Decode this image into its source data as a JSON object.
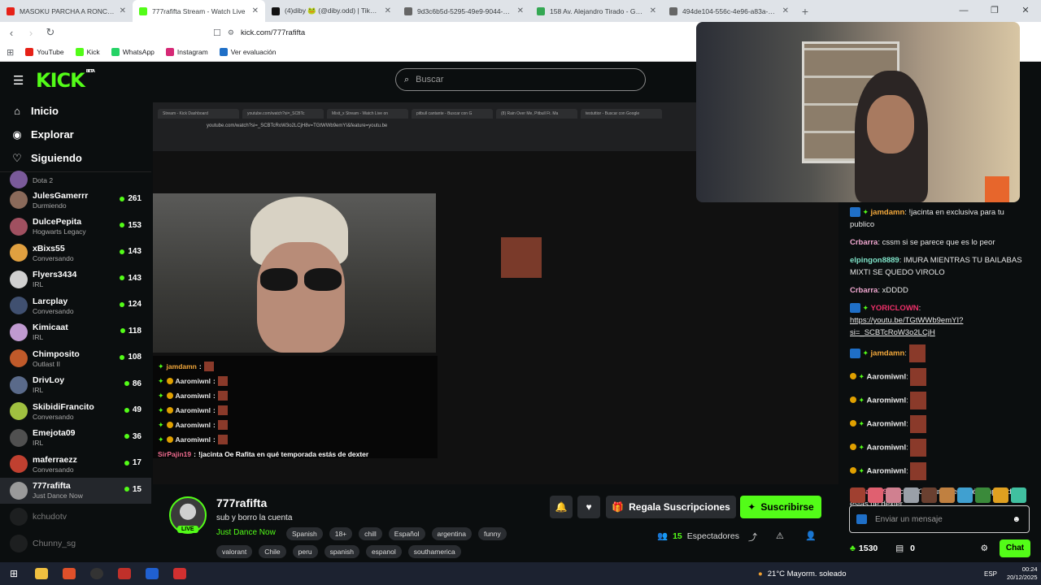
{
  "browser": {
    "tabs": [
      {
        "title": "MASOKU PARCHA A RONCHAS",
        "color": "#e62117",
        "active": false
      },
      {
        "title": "777rafifta Stream - Watch Live",
        "color": "#53fc18",
        "active": true
      },
      {
        "title": "(4)diby 🐸 (@diby.odd) | TikTok",
        "color": "#111111",
        "active": false
      },
      {
        "title": "9d3c6b5d-5295-49e9-9044-95eba9b",
        "color": "#666666",
        "active": false
      },
      {
        "title": "158 Av. Alejandro Tirado - Google M",
        "color": "#34a853",
        "active": false
      },
      {
        "title": "494de104-556c-4e96-a83a-1e4902d9",
        "color": "#666666",
        "active": false
      }
    ],
    "url": "kick.com/777rafifta",
    "bookmarks": [
      {
        "label": "YouTube",
        "color": "#e62117"
      },
      {
        "label": "Kick",
        "color": "#53fc18"
      },
      {
        "label": "WhatsApp",
        "color": "#25d366"
      },
      {
        "label": "Instagram",
        "color": "#d62976"
      },
      {
        "label": "Ver evaluación",
        "color": "#1f6fc7"
      }
    ]
  },
  "kick": {
    "logo": "KICK",
    "beta": "BETA",
    "search_placeholder": "Buscar",
    "nav": [
      {
        "label": "Inicio",
        "icon": "home-icon"
      },
      {
        "label": "Explorar",
        "icon": "compass-icon"
      },
      {
        "label": "Siguiendo",
        "icon": "heart-icon"
      }
    ],
    "channels": [
      {
        "name": "",
        "category": "Dota 2",
        "viewers": "",
        "color": "#7a5a9a",
        "state": "partial"
      },
      {
        "name": "JulesGamerrr",
        "category": "Durmiendo",
        "viewers": "261",
        "color": "#8a6a5a",
        "state": "on"
      },
      {
        "name": "DulcePepita",
        "category": "Hogwarts Legacy",
        "viewers": "153",
        "color": "#a05060",
        "state": "on"
      },
      {
        "name": "xBixs55",
        "category": "Conversando",
        "viewers": "143",
        "color": "#e0a040",
        "state": "on"
      },
      {
        "name": "Flyers3434",
        "category": "IRL",
        "viewers": "143",
        "color": "#d0d0d0",
        "state": "on"
      },
      {
        "name": "Larcplay",
        "category": "Conversando",
        "viewers": "124",
        "color": "#405070",
        "state": "on"
      },
      {
        "name": "Kimicaat",
        "category": "IRL",
        "viewers": "118",
        "color": "#c09ad0",
        "state": "on"
      },
      {
        "name": "Chimposito",
        "category": "Outlast II",
        "viewers": "108",
        "color": "#c05a2a",
        "state": "on"
      },
      {
        "name": "DrivLoy",
        "category": "IRL",
        "viewers": "86",
        "color": "#5a6a8a",
        "state": "on"
      },
      {
        "name": "SkibidiFrancito",
        "category": "Conversando",
        "viewers": "49",
        "color": "#a0c040",
        "state": "on"
      },
      {
        "name": "Emejota09",
        "category": "IRL",
        "viewers": "36",
        "color": "#505050",
        "state": "on"
      },
      {
        "name": "maferraezz",
        "category": "Conversando",
        "viewers": "17",
        "color": "#c04030",
        "state": "on"
      },
      {
        "name": "777rafifta",
        "category": "Just Dance Now",
        "viewers": "15",
        "color": "#9a9a9a",
        "state": "active"
      },
      {
        "name": "kchudotv",
        "category": "",
        "viewers": "",
        "color": "#3a3a3a",
        "state": "off"
      },
      {
        "name": "Chunny_sg",
        "category": "",
        "viewers": "",
        "color": "#3a3a3a",
        "state": "off"
      }
    ],
    "inner_tabs": [
      "Stream - Kick Dashboard",
      "youtube.com/watch?si=_SCBTc",
      "Mixit_x Stream - Watch Live on",
      "pitbull cantante - Buscar con G",
      "(8) Rain Over Me, Pitbull Ft. Ma",
      "testuttior - Buscar con Google"
    ],
    "inner_url": "youtube.com/watch?si=_SCBTcRoW3o2LCjH8v=TGtWWb9emYI&feature=youtu.be",
    "overlay_chat": [
      {
        "user": "jamdamn",
        "text": "",
        "cls": "u1"
      },
      {
        "user": "Aaromiwnl",
        "text": "",
        "cls": "u2"
      },
      {
        "user": "Aaromiwnl",
        "text": "",
        "cls": "u2"
      },
      {
        "user": "Aaromiwnl",
        "text": "",
        "cls": "u2"
      },
      {
        "user": "Aaromiwnl",
        "text": "",
        "cls": "u2"
      },
      {
        "user": "Aaromiwnl",
        "text": "",
        "cls": "u2"
      },
      {
        "user": "SirPajin19",
        "text": "!jacinta Oe Rafita en qué temporada estás de dexter",
        "cls": "u3"
      }
    ],
    "streamer": {
      "name": "777rafifta",
      "live": "LIVE",
      "title": "sub y borro la cuenta",
      "category": "Just Dance Now",
      "tags_row1": [
        "Spanish",
        "18+",
        "chill",
        "Español",
        "argentina",
        "funny"
      ],
      "tags_row2": [
        "valorant",
        "Chile",
        "peru",
        "spanish",
        "espanol",
        "southamerica"
      ],
      "gift_label": "Regala Suscripciones",
      "sub_label": "Suscribirse",
      "viewers_count": "15",
      "viewers_label": "Espectadores"
    },
    "chat": {
      "messages": [
        {
          "user": "jamdamn",
          "color": "#f3a83b",
          "text": "!jacinta en exclusiva para tu publico",
          "link": "",
          "emote": false,
          "badges": "gem"
        },
        {
          "user": "Crbarra",
          "color": "#f0a8d0",
          "text": "cssm si se parece que es lo peor",
          "link": "",
          "emote": false,
          "badges": ""
        },
        {
          "user": "elpingon8889",
          "color": "#7fe3c8",
          "text": "IMURA MIENTRAS TU BAILABAS MIXTI SE QUEDO VIROLO",
          "link": "",
          "emote": false,
          "badges": ""
        },
        {
          "user": "Crbarra",
          "color": "#f0a8d0",
          "text": "xDDDD",
          "link": "",
          "emote": false,
          "badges": ""
        },
        {
          "user": "YORICLOWN",
          "color": "#f0306a",
          "text": "",
          "link": "https://youtu.be/TGtWWb9emYI?si=_SCBTcRoW3o2LCjH",
          "emote": false,
          "badges": "gem"
        },
        {
          "user": "jamdamn",
          "color": "#f3a83b",
          "text": "",
          "link": "",
          "emote": true,
          "badges": "gem"
        },
        {
          "user": "Aaromiwnl",
          "color": "#e8e8e8",
          "text": "",
          "link": "",
          "emote": true,
          "badges": "sub"
        },
        {
          "user": "Aaromiwnl",
          "color": "#e8e8e8",
          "text": "",
          "link": "",
          "emote": true,
          "badges": "sub"
        },
        {
          "user": "Aaromiwnl",
          "color": "#e8e8e8",
          "text": "",
          "link": "",
          "emote": true,
          "badges": "sub"
        },
        {
          "user": "Aaromiwnl",
          "color": "#e8e8e8",
          "text": "",
          "link": "",
          "emote": true,
          "badges": "sub"
        },
        {
          "user": "Aaromiwnl",
          "color": "#e8e8e8",
          "text": "",
          "link": "",
          "emote": true,
          "badges": "sub"
        },
        {
          "user": "SirPajin19",
          "color": "#f06c8f",
          "text": "!jacinta Oe Rafita en qué temporada estás de dexter",
          "link": "",
          "emote": false,
          "badges": ""
        }
      ],
      "emote_colors": [
        "#a04030",
        "#e06070",
        "#d08090",
        "#9aa0a8",
        "#6a4030",
        "#c08040",
        "#40a0d0",
        "#3a8a3a",
        "#e0a020",
        "#40c0a0"
      ],
      "input_placeholder": "Enviar un mensaje",
      "points": "1530",
      "tickets": "0",
      "chat_button": "Chat"
    }
  },
  "taskbar": {
    "weather": "21°C  Mayorm. soleado",
    "lang": "ESP",
    "time": "00:24",
    "date": "20/12/2025"
  }
}
